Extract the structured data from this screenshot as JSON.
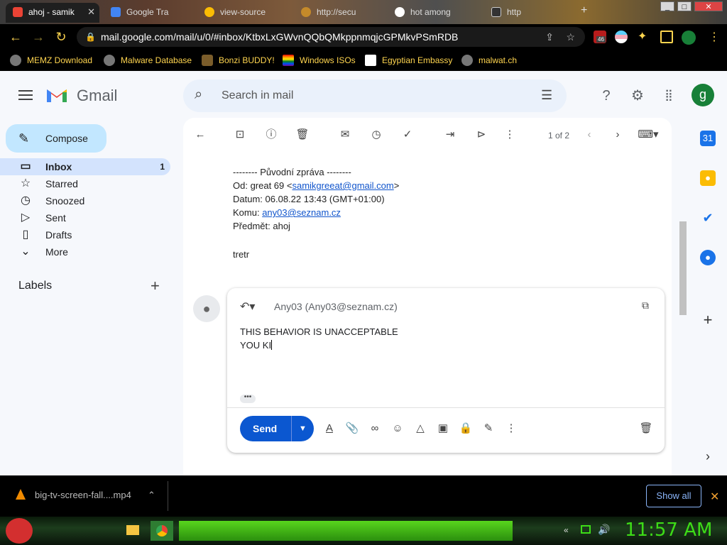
{
  "browser": {
    "tabs": [
      {
        "title": "ahoj - samik",
        "active": true
      },
      {
        "title": "Google Tra"
      },
      {
        "title": "view-source"
      },
      {
        "title": "http://secu"
      },
      {
        "title": "hot among"
      },
      {
        "title": "http"
      }
    ],
    "url": "mail.google.com/mail/u/0/#inbox/KtbxLxGWvnQQbQMkppnmqjcGPMkvPSmRDB",
    "extension_badge": "46",
    "bookmarks": [
      "MEMZ Download",
      "Malware Database",
      "Bonzi BUDDY!",
      "Windows ISOs",
      "Egyptian Embassy",
      "malwat.ch"
    ]
  },
  "gmail": {
    "logo_text": "Gmail",
    "search_placeholder": "Search in mail",
    "avatar_letter": "g",
    "compose_label": "Compose",
    "nav": [
      {
        "label": "Inbox",
        "count": "1"
      },
      {
        "label": "Starred"
      },
      {
        "label": "Snoozed"
      },
      {
        "label": "Sent"
      },
      {
        "label": "Drafts"
      },
      {
        "label": "More"
      }
    ],
    "labels_heading": "Labels",
    "pager": "1 of 2"
  },
  "message": {
    "quoted_header": "-------- Původní zpráva --------",
    "from_prefix": "Od: great 69 <",
    "from_email": "samikgreeat@gmail.com",
    "from_suffix": ">",
    "date_line": "Datum: 06.08.22 13:43 (GMT+01:00)",
    "to_prefix": "Komu: ",
    "to_email": "any03@seznam.cz",
    "subject_line": "Předmět: ahoj",
    "body": "tretr"
  },
  "reply": {
    "to": "Any03 (Any03@seznam.cz)",
    "line1": "THIS BEHAVIOR IS UNACCEPTABLE",
    "line2": "YOU KI",
    "send_label": "Send"
  },
  "download": {
    "filename": "big-tv-screen-fall....mp4",
    "show_all": "Show all"
  },
  "taskbar": {
    "clock": "11:57 AM"
  }
}
